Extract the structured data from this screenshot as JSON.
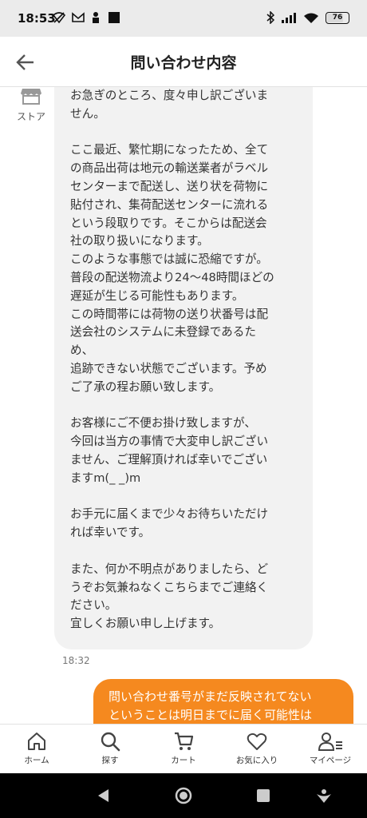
{
  "status_bar": {
    "time": "18:53",
    "battery": "76"
  },
  "header": {
    "title": "問い合わせ内容"
  },
  "store": {
    "label": "ストア"
  },
  "messages": [
    {
      "from": "store",
      "text": "お急ぎのところ、度々申し訳ございま\nせん。\n\nここ最近、繁忙期になったため、全て\nの商品出荷は地元の輸送業者がラベル\nセンターまで配送し、送り状を荷物に\n貼付され、集荷配送センターに流れる\nという段取りです。そこからは配送会\n社の取り扱いになります。\nこのような事態では誠に恐縮ですが。\n普段の配送物流より24〜48時間ほどの\n遅延が生じる可能性もあります。\nこの時間帯には荷物の送り状番号は配\n送会社のシステムに未登録であるた\nめ、\n追跡できない状態でございます。予め\nご了承の程お願い致します。\n\nお客様にご不便お掛け致しますが、\n今回は当方の事情で大変申し訳ござい\nません、ご理解頂ければ幸いでござい\nますm(_ _)m\n\nお手元に届くまで少々お待ちいただけ\nれば幸いです。\n\nまた、何か不明点がありましたら、ど\nうぞお気兼ねなくこちらまでご連絡く\nださい。\n宜しくお願い申し上げます。",
      "time": "18:32"
    },
    {
      "from": "user",
      "text": "問い合わせ番号がまだ反映されてない\nということは明日までに届く可能性は"
    }
  ],
  "bottom_nav": [
    {
      "icon": "home-icon",
      "label": "ホーム"
    },
    {
      "icon": "search-icon",
      "label": "探す"
    },
    {
      "icon": "cart-icon",
      "label": "カート"
    },
    {
      "icon": "heart-icon",
      "label": "お気に入り"
    },
    {
      "icon": "mypage-icon",
      "label": "マイページ"
    }
  ],
  "colors": {
    "accent": "#f5891f",
    "bubble_in": "#f2f2f2"
  }
}
